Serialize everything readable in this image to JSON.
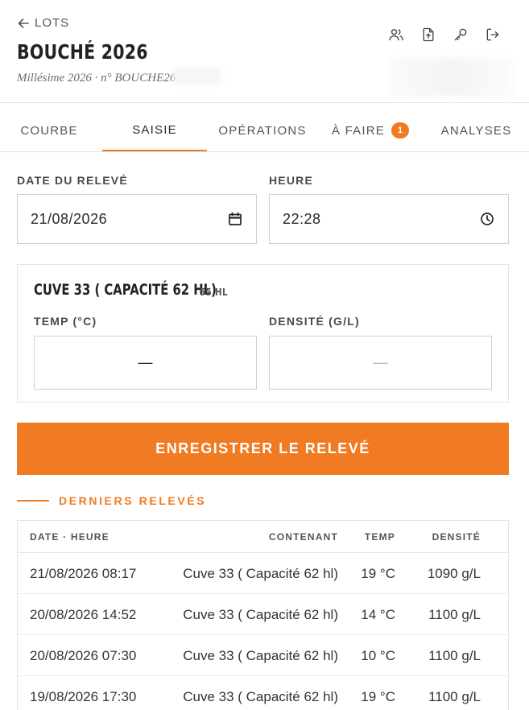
{
  "header": {
    "back_label": "LOTS",
    "title": "BOUCHÉ 2026",
    "subtitle": "Millésime 2026 · n° BOUCHE26"
  },
  "tabs": [
    {
      "label": "COURBE"
    },
    {
      "label": "SAISIE"
    },
    {
      "label": "OPÉRATIONS"
    },
    {
      "label": "À FAIRE",
      "badge": "1"
    },
    {
      "label": "ANALYSES"
    }
  ],
  "form": {
    "date_label": "DATE DU RELEVÉ",
    "date_value": "21/08/2026",
    "time_label": "HEURE",
    "time_value": "22:28"
  },
  "tank": {
    "title": "CUVE 33 ( CAPACITÉ 62 HL)",
    "volume": "55 HL",
    "temp_label": "TEMP (°C)",
    "temp_placeholder": "—",
    "density_label": "DENSITÉ (G/L)",
    "density_placeholder": "—"
  },
  "save_button": "ENREGISTRER LE RELEVÉ",
  "history": {
    "title": "DERNIERS RELEVÉS",
    "columns": [
      "DATE · HEURE",
      "CONTENANT",
      "TEMP",
      "DENSITÉ"
    ],
    "rows": [
      {
        "date": "21/08/2026 08:17",
        "container": "Cuve 33 ( Capacité 62 hl)",
        "temp": "19 °C",
        "density": "1090 g/L"
      },
      {
        "date": "20/08/2026 14:52",
        "container": "Cuve 33 ( Capacité 62 hl)",
        "temp": "14 °C",
        "density": "1100 g/L"
      },
      {
        "date": "20/08/2026 07:30",
        "container": "Cuve 33 ( Capacité 62 hl)",
        "temp": "10 °C",
        "density": "1100 g/L"
      },
      {
        "date": "19/08/2026 17:30",
        "container": "Cuve 33 ( Capacité 62 hl)",
        "temp": "19 °C",
        "density": "1100 g/L"
      }
    ]
  },
  "colors": {
    "accent": "#f07b22",
    "text": "#2b2b2b",
    "border": "#cfcfcf"
  },
  "icons": [
    "arrow-left-icon",
    "users-icon",
    "file-upload-icon",
    "key-icon",
    "logout-icon",
    "calendar-icon",
    "clock-icon"
  ]
}
